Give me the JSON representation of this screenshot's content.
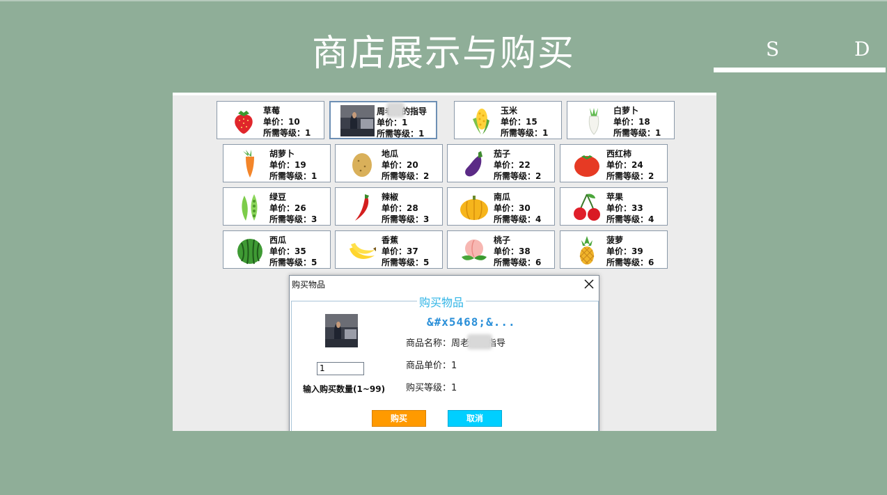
{
  "slide": {
    "title": "商店展示与购买",
    "corner_left": "S",
    "corner_right": "D"
  },
  "shop": {
    "items": [
      {
        "name": "草莓",
        "price": "单价：10",
        "level": "所需等级：1",
        "icon": "strawberry-icon"
      },
      {
        "name": "周老师的指导",
        "price": "单价：1",
        "level": "所需等级：1",
        "icon": "teacher-photo"
      },
      {
        "name": "玉米",
        "price": "单价：15",
        "level": "所需等级：1",
        "icon": "corn-icon"
      },
      {
        "name": "白萝卜",
        "price": "单价：18",
        "level": "所需等级：1",
        "icon": "radish-icon"
      },
      {
        "name": "胡萝卜",
        "price": "单价：19",
        "level": "所需等级：1",
        "icon": "carrot-icon"
      },
      {
        "name": "地瓜",
        "price": "单价：20",
        "level": "所需等级：2",
        "icon": "potato-icon"
      },
      {
        "name": "茄子",
        "price": "单价：22",
        "level": "所需等级：2",
        "icon": "eggplant-icon"
      },
      {
        "name": "西红柿",
        "price": "单价：24",
        "level": "所需等级：2",
        "icon": "tomato-icon"
      },
      {
        "name": "绿豆",
        "price": "单价：26",
        "level": "所需等级：3",
        "icon": "peas-icon"
      },
      {
        "name": "辣椒",
        "price": "单价：28",
        "level": "所需等级：3",
        "icon": "chili-icon"
      },
      {
        "name": "南瓜",
        "price": "单价：30",
        "level": "所需等级：4",
        "icon": "pumpkin-icon"
      },
      {
        "name": "苹果",
        "price": "单价：33",
        "level": "所需等级：4",
        "icon": "cherry-icon"
      },
      {
        "name": "西瓜",
        "price": "单价：35",
        "level": "所需等级：5",
        "icon": "watermelon-icon"
      },
      {
        "name": "香蕉",
        "price": "单价：37",
        "level": "所需等级：5",
        "icon": "banana-icon"
      },
      {
        "name": "桃子",
        "price": "单价：38",
        "level": "所需等级：6",
        "icon": "peach-icon"
      },
      {
        "name": "菠萝",
        "price": "单价：39",
        "level": "所需等级：6",
        "icon": "pineapple-icon"
      }
    ]
  },
  "dialog": {
    "title": "购买物品",
    "legend": "购买物品",
    "heading": "&#x5468;&...",
    "name_row": "商品名称：周老师的指导",
    "price_row": "商品单价：1",
    "level_row": "购买等级：1",
    "quantity_value": "1",
    "quantity_label": "输入购买数量(1~99)",
    "buy_label": "购买",
    "cancel_label": "取消",
    "buy_color": "#ff9a00",
    "cancel_color": "#00cfff"
  }
}
